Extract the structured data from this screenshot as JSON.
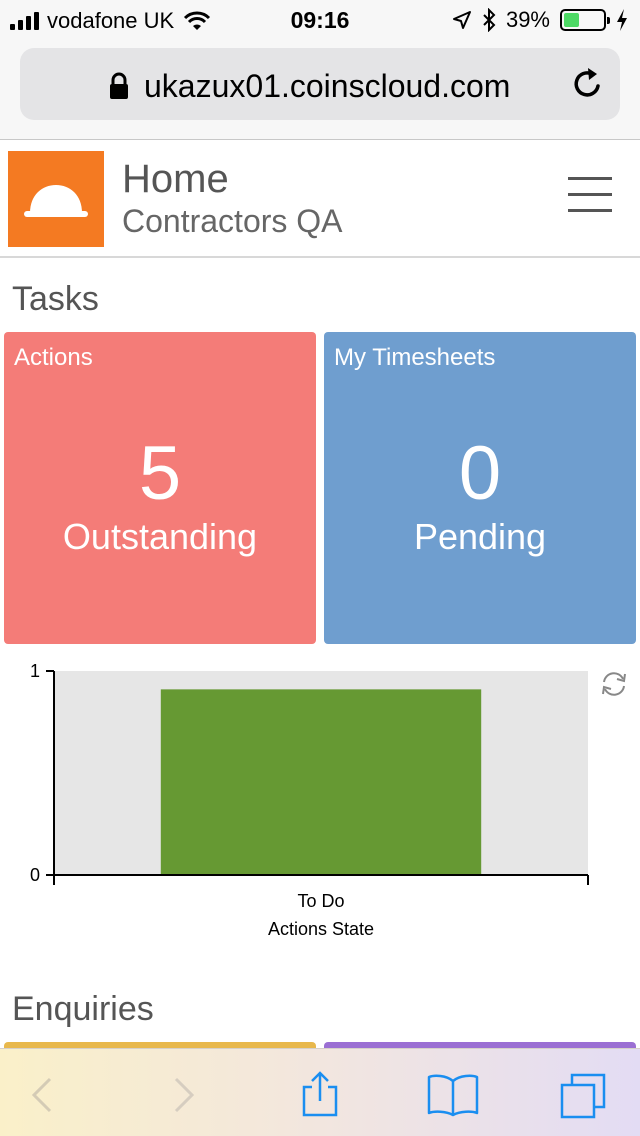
{
  "status_bar": {
    "carrier": "vodafone UK",
    "time": "09:16",
    "battery": "39%",
    "battery_level": 0.39,
    "icons": [
      "signal-icon",
      "wifi-icon",
      "location-icon",
      "bluetooth-icon",
      "battery-icon",
      "charging-icon"
    ]
  },
  "browser": {
    "url": "ukazux01.coinscloud.com",
    "icons": [
      "lock-icon",
      "reload-icon"
    ]
  },
  "header": {
    "title": "Home",
    "subtitle": "Contractors QA",
    "icons": [
      "hard-hat-icon",
      "hamburger-menu-icon"
    ],
    "logo_color": "#f47a22"
  },
  "tasks": {
    "title": "Tasks",
    "tiles": [
      {
        "label": "Actions",
        "value": "5",
        "caption": "Outstanding",
        "color": "#f47c78"
      },
      {
        "label": "My Timesheets",
        "value": "0",
        "caption": "Pending",
        "color": "#6f9ecf"
      }
    ]
  },
  "chart_data": {
    "type": "bar",
    "categories": [
      "To Do"
    ],
    "values": [
      0.91
    ],
    "xlabel": "Actions State",
    "ylabel": "",
    "ylim": [
      0,
      1
    ],
    "yticks": [
      "0",
      "1"
    ],
    "bar_color": "#669933",
    "plot_background": "#e6e6e6",
    "grid": false
  },
  "chart_controls": {
    "icons": [
      "refresh-icon"
    ]
  },
  "enquiries": {
    "title": "Enquiries",
    "tile_colors": [
      "#e8b84c",
      "#9b6fd3"
    ]
  },
  "toolbar": {
    "icons": [
      "back-icon",
      "forward-icon",
      "share-icon",
      "bookmarks-icon",
      "tabs-icon"
    ],
    "accent": "#1a8ef0"
  }
}
